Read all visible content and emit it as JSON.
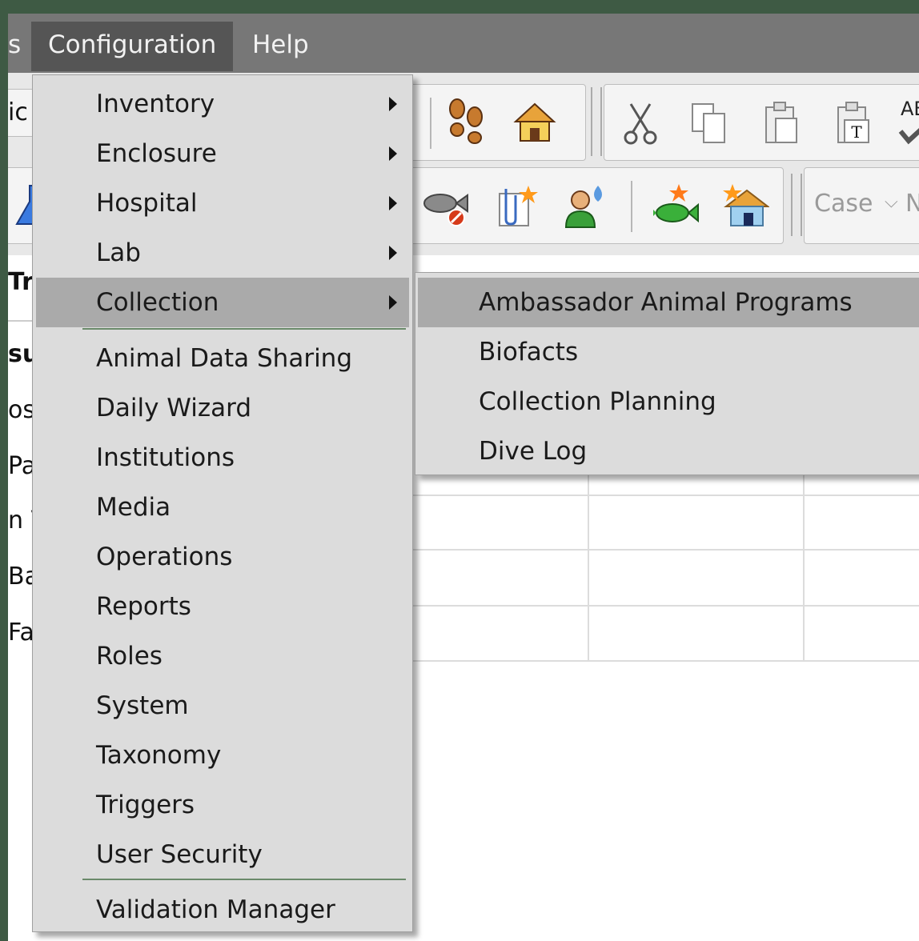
{
  "menubar": {
    "partial_left": "s",
    "items": [
      {
        "label": "Configuration",
        "active": true
      },
      {
        "label": "Help",
        "active": false
      }
    ]
  },
  "toolbar": {
    "case_label": "Case",
    "case_dropdown": "⌵",
    "case_input_partial": "N",
    "text_tool_partial": "AB",
    "icons": {
      "footprints": "footprints-icon",
      "house": "house-icon",
      "cut": "scissors-icon",
      "copy": "copy-icon",
      "paste": "paste-icon",
      "paste_text": "paste-text-icon",
      "spellcheck": "spellcheck-icon",
      "flask": "flask-icon",
      "fish_remove": "fish-remove-icon",
      "new_document": "new-document-icon",
      "person": "person-icon",
      "fish_new": "fish-new-icon",
      "house_new": "house-new-icon"
    }
  },
  "left_strip": {
    "lines": [
      "ic",
      "Tra",
      "su",
      "osi",
      "Pa",
      "n V",
      "Ba",
      "Fa"
    ]
  },
  "dropdown": {
    "items": [
      {
        "label": "Inventory",
        "submenu": true
      },
      {
        "label": "Enclosure",
        "submenu": true
      },
      {
        "label": "Hospital",
        "submenu": true
      },
      {
        "label": "Lab",
        "submenu": true
      },
      {
        "label": "Collection",
        "submenu": true,
        "highlighted": true
      },
      {
        "label": "Animal Data Sharing"
      },
      {
        "label": "Daily Wizard"
      },
      {
        "label": "Institutions"
      },
      {
        "label": "Media"
      },
      {
        "label": "Operations"
      },
      {
        "label": "Reports"
      },
      {
        "label": "Roles"
      },
      {
        "label": "System"
      },
      {
        "label": "Taxonomy"
      },
      {
        "label": "Triggers"
      },
      {
        "label": "User Security"
      },
      {
        "label": "Validation Manager"
      }
    ]
  },
  "submenu": {
    "items": [
      {
        "label": "Ambassador Animal Programs",
        "highlighted": true
      },
      {
        "label": "Biofacts"
      },
      {
        "label": "Collection Planning"
      },
      {
        "label": "Dive Log"
      }
    ]
  },
  "colors": {
    "menubar_bg": "#777777",
    "menubar_active": "#555555",
    "menu_bg": "#dcdcdc",
    "menu_highlight": "#aaaaaa",
    "separator": "#6a8a6a"
  }
}
